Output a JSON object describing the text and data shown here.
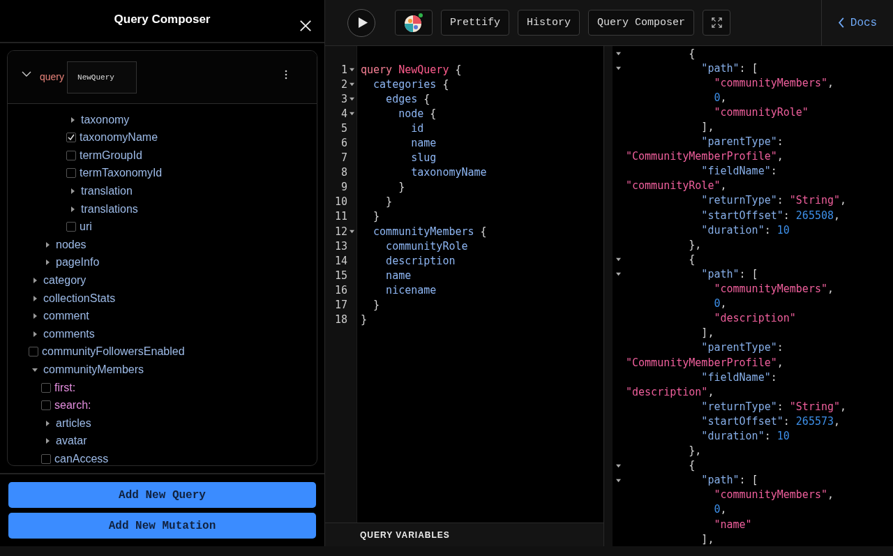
{
  "composer": {
    "title": "Query Composer",
    "operation": {
      "type": "query",
      "name": "NewQuery"
    },
    "tree": [
      {
        "children": [
          {
            "children": [
              {
                "children": [
                  {
                    "kind": "object",
                    "label": "taxonomy",
                    "expanded": false
                  },
                  {
                    "kind": "field",
                    "label": "taxonomyName",
                    "checked": true
                  },
                  {
                    "kind": "field",
                    "label": "termGroupId",
                    "checked": false
                  },
                  {
                    "kind": "field",
                    "label": "termTaxonomyId",
                    "checked": false
                  },
                  {
                    "kind": "object",
                    "label": "translation",
                    "expanded": false
                  },
                  {
                    "kind": "object",
                    "label": "translations",
                    "expanded": false
                  },
                  {
                    "kind": "field",
                    "label": "uri",
                    "checked": false
                  }
                ]
              }
            ]
          },
          {
            "kind": "object",
            "label": "nodes",
            "expanded": false
          },
          {
            "kind": "object",
            "label": "pageInfo",
            "expanded": false
          }
        ]
      },
      {
        "kind": "object",
        "label": "category",
        "expanded": false
      },
      {
        "kind": "object",
        "label": "collectionStats",
        "expanded": false
      },
      {
        "kind": "object",
        "label": "comment",
        "expanded": false
      },
      {
        "kind": "object",
        "label": "comments",
        "expanded": false
      },
      {
        "kind": "field",
        "label": "communityFollowersEnabled",
        "checked": false
      },
      {
        "kind": "object",
        "label": "communityMembers",
        "expanded": true,
        "children": [
          {
            "kind": "argument",
            "label": "first:",
            "checked": false
          },
          {
            "kind": "argument",
            "label": "search:",
            "checked": false
          },
          {
            "kind": "object",
            "label": "articles",
            "expanded": false
          },
          {
            "kind": "object",
            "label": "avatar",
            "expanded": false
          },
          {
            "kind": "field",
            "label": "canAccess",
            "checked": false
          }
        ]
      }
    ],
    "buttons": [
      "Add New Query",
      "Add New Mutation"
    ]
  },
  "toolbar": {
    "buttons": [
      "Prettify",
      "History",
      "Query Composer"
    ],
    "docs": "Docs"
  },
  "editor": {
    "lines": [
      {
        "number": "1",
        "fold": true,
        "tokens": [
          {
            "kind": "keyword",
            "text": "query "
          },
          {
            "kind": "def",
            "text": "NewQuery"
          },
          {
            "kind": "punct",
            "text": " {"
          }
        ]
      },
      {
        "number": "2",
        "fold": true,
        "tokens": [
          {
            "kind": "field",
            "text": "  categories"
          },
          {
            "kind": "punct",
            "text": " {"
          }
        ]
      },
      {
        "number": "3",
        "fold": true,
        "tokens": [
          {
            "kind": "field",
            "text": "    edges"
          },
          {
            "kind": "punct",
            "text": " {"
          }
        ]
      },
      {
        "number": "4",
        "fold": true,
        "tokens": [
          {
            "kind": "field",
            "text": "      node"
          },
          {
            "kind": "punct",
            "text": " {"
          }
        ]
      },
      {
        "number": "5",
        "fold": false,
        "tokens": [
          {
            "kind": "field",
            "text": "        id"
          }
        ]
      },
      {
        "number": "6",
        "fold": false,
        "tokens": [
          {
            "kind": "field",
            "text": "        name"
          }
        ]
      },
      {
        "number": "7",
        "fold": false,
        "tokens": [
          {
            "kind": "field",
            "text": "        slug"
          }
        ]
      },
      {
        "number": "8",
        "fold": false,
        "tokens": [
          {
            "kind": "field",
            "text": "        taxonomyName"
          }
        ]
      },
      {
        "number": "9",
        "fold": false,
        "tokens": [
          {
            "kind": "punct",
            "text": "      }"
          }
        ]
      },
      {
        "number": "10",
        "fold": false,
        "tokens": [
          {
            "kind": "punct",
            "text": "    }"
          }
        ]
      },
      {
        "number": "11",
        "fold": false,
        "tokens": [
          {
            "kind": "punct",
            "text": "  }"
          }
        ]
      },
      {
        "number": "12",
        "fold": true,
        "tokens": [
          {
            "kind": "field",
            "text": "  communityMembers"
          },
          {
            "kind": "punct",
            "text": " {"
          }
        ]
      },
      {
        "number": "13",
        "fold": false,
        "tokens": [
          {
            "kind": "field",
            "text": "    communityRole"
          }
        ]
      },
      {
        "number": "14",
        "fold": false,
        "tokens": [
          {
            "kind": "field",
            "text": "    description"
          }
        ]
      },
      {
        "number": "15",
        "fold": false,
        "tokens": [
          {
            "kind": "field",
            "text": "    name"
          }
        ]
      },
      {
        "number": "16",
        "fold": false,
        "tokens": [
          {
            "kind": "field",
            "text": "    nicename"
          }
        ]
      },
      {
        "number": "17",
        "fold": false,
        "tokens": [
          {
            "kind": "punct",
            "text": "  }"
          }
        ]
      },
      {
        "number": "18",
        "fold": false,
        "tokens": [
          {
            "kind": "punct",
            "text": "}"
          }
        ]
      }
    ],
    "variables_label": "QUERY VARIABLES"
  },
  "results": {
    "lines": [
      {
        "fold": true,
        "tokens": [
          {
            "kind": "punct",
            "text": "          {"
          }
        ]
      },
      {
        "fold": true,
        "tokens": [
          {
            "kind": "key",
            "text": "            \"path\""
          },
          {
            "kind": "punct",
            "text": ": ["
          }
        ]
      },
      {
        "fold": false,
        "tokens": [
          {
            "kind": "string",
            "text": "              \"communityMembers\""
          },
          {
            "kind": "punct",
            "text": ","
          }
        ]
      },
      {
        "fold": false,
        "tokens": [
          {
            "kind": "number",
            "text": "              0"
          },
          {
            "kind": "punct",
            "text": ","
          }
        ]
      },
      {
        "fold": false,
        "tokens": [
          {
            "kind": "string",
            "text": "              \"communityRole\""
          }
        ]
      },
      {
        "fold": false,
        "tokens": [
          {
            "kind": "punct",
            "text": "            ],"
          }
        ]
      },
      {
        "fold": false,
        "tokens": [
          {
            "kind": "key",
            "text": "            \"parentType\""
          },
          {
            "kind": "punct",
            "text": ":"
          }
        ]
      },
      {
        "fold": false,
        "tokens": [
          {
            "kind": "string",
            "text": "\"CommunityMemberProfile\""
          },
          {
            "kind": "punct",
            "text": ","
          }
        ]
      },
      {
        "fold": false,
        "tokens": [
          {
            "kind": "key",
            "text": "            \"fieldName\""
          },
          {
            "kind": "punct",
            "text": ":"
          }
        ]
      },
      {
        "fold": false,
        "tokens": [
          {
            "kind": "string",
            "text": "\"communityRole\""
          },
          {
            "kind": "punct",
            "text": ","
          }
        ]
      },
      {
        "fold": false,
        "tokens": [
          {
            "kind": "key",
            "text": "            \"returnType\""
          },
          {
            "kind": "punct",
            "text": ": "
          },
          {
            "kind": "string",
            "text": "\"String\""
          },
          {
            "kind": "punct",
            "text": ","
          }
        ]
      },
      {
        "fold": false,
        "tokens": [
          {
            "kind": "key",
            "text": "            \"startOffset\""
          },
          {
            "kind": "punct",
            "text": ": "
          },
          {
            "kind": "number",
            "text": "265508"
          },
          {
            "kind": "punct",
            "text": ","
          }
        ]
      },
      {
        "fold": false,
        "tokens": [
          {
            "kind": "key",
            "text": "            \"duration\""
          },
          {
            "kind": "punct",
            "text": ": "
          },
          {
            "kind": "number",
            "text": "10"
          }
        ]
      },
      {
        "fold": false,
        "tokens": [
          {
            "kind": "punct",
            "text": "          },"
          }
        ]
      },
      {
        "fold": true,
        "tokens": [
          {
            "kind": "punct",
            "text": "          {"
          }
        ]
      },
      {
        "fold": true,
        "tokens": [
          {
            "kind": "key",
            "text": "            \"path\""
          },
          {
            "kind": "punct",
            "text": ": ["
          }
        ]
      },
      {
        "fold": false,
        "tokens": [
          {
            "kind": "string",
            "text": "              \"communityMembers\""
          },
          {
            "kind": "punct",
            "text": ","
          }
        ]
      },
      {
        "fold": false,
        "tokens": [
          {
            "kind": "number",
            "text": "              0"
          },
          {
            "kind": "punct",
            "text": ","
          }
        ]
      },
      {
        "fold": false,
        "tokens": [
          {
            "kind": "string",
            "text": "              \"description\""
          }
        ]
      },
      {
        "fold": false,
        "tokens": [
          {
            "kind": "punct",
            "text": "            ],"
          }
        ]
      },
      {
        "fold": false,
        "tokens": [
          {
            "kind": "key",
            "text": "            \"parentType\""
          },
          {
            "kind": "punct",
            "text": ":"
          }
        ]
      },
      {
        "fold": false,
        "tokens": [
          {
            "kind": "string",
            "text": "\"CommunityMemberProfile\""
          },
          {
            "kind": "punct",
            "text": ","
          }
        ]
      },
      {
        "fold": false,
        "tokens": [
          {
            "kind": "key",
            "text": "            \"fieldName\""
          },
          {
            "kind": "punct",
            "text": ":"
          }
        ]
      },
      {
        "fold": false,
        "tokens": [
          {
            "kind": "string",
            "text": "\"description\""
          },
          {
            "kind": "punct",
            "text": ","
          }
        ]
      },
      {
        "fold": false,
        "tokens": [
          {
            "kind": "key",
            "text": "            \"returnType\""
          },
          {
            "kind": "punct",
            "text": ": "
          },
          {
            "kind": "string",
            "text": "\"String\""
          },
          {
            "kind": "punct",
            "text": ","
          }
        ]
      },
      {
        "fold": false,
        "tokens": [
          {
            "kind": "key",
            "text": "            \"startOffset\""
          },
          {
            "kind": "punct",
            "text": ": "
          },
          {
            "kind": "number",
            "text": "265573"
          },
          {
            "kind": "punct",
            "text": ","
          }
        ]
      },
      {
        "fold": false,
        "tokens": [
          {
            "kind": "key",
            "text": "            \"duration\""
          },
          {
            "kind": "punct",
            "text": ": "
          },
          {
            "kind": "number",
            "text": "10"
          }
        ]
      },
      {
        "fold": false,
        "tokens": [
          {
            "kind": "punct",
            "text": "          },"
          }
        ]
      },
      {
        "fold": true,
        "tokens": [
          {
            "kind": "punct",
            "text": "          {"
          }
        ]
      },
      {
        "fold": true,
        "tokens": [
          {
            "kind": "key",
            "text": "            \"path\""
          },
          {
            "kind": "punct",
            "text": ": ["
          }
        ]
      },
      {
        "fold": false,
        "tokens": [
          {
            "kind": "string",
            "text": "              \"communityMembers\""
          },
          {
            "kind": "punct",
            "text": ","
          }
        ]
      },
      {
        "fold": false,
        "tokens": [
          {
            "kind": "number",
            "text": "              0"
          },
          {
            "kind": "punct",
            "text": ","
          }
        ]
      },
      {
        "fold": false,
        "tokens": [
          {
            "kind": "string",
            "text": "              \"name\""
          }
        ]
      },
      {
        "fold": false,
        "tokens": [
          {
            "kind": "punct",
            "text": "            ],"
          }
        ]
      }
    ]
  }
}
